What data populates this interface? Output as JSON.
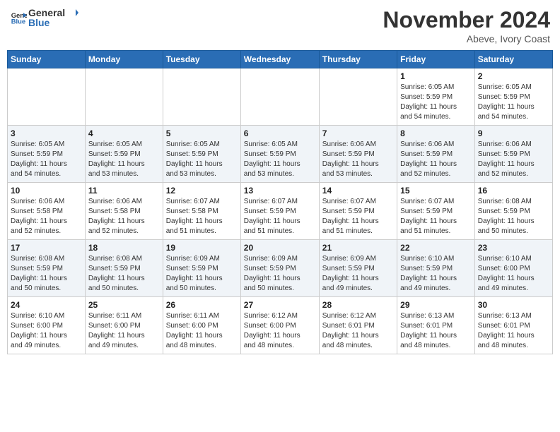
{
  "header": {
    "logo_general": "General",
    "logo_blue": "Blue",
    "month_year": "November 2024",
    "location": "Abeve, Ivory Coast"
  },
  "days_of_week": [
    "Sunday",
    "Monday",
    "Tuesday",
    "Wednesday",
    "Thursday",
    "Friday",
    "Saturday"
  ],
  "weeks": [
    [
      {
        "day": "",
        "info": ""
      },
      {
        "day": "",
        "info": ""
      },
      {
        "day": "",
        "info": ""
      },
      {
        "day": "",
        "info": ""
      },
      {
        "day": "",
        "info": ""
      },
      {
        "day": "1",
        "info": "Sunrise: 6:05 AM\nSunset: 5:59 PM\nDaylight: 11 hours\nand 54 minutes."
      },
      {
        "day": "2",
        "info": "Sunrise: 6:05 AM\nSunset: 5:59 PM\nDaylight: 11 hours\nand 54 minutes."
      }
    ],
    [
      {
        "day": "3",
        "info": "Sunrise: 6:05 AM\nSunset: 5:59 PM\nDaylight: 11 hours\nand 54 minutes."
      },
      {
        "day": "4",
        "info": "Sunrise: 6:05 AM\nSunset: 5:59 PM\nDaylight: 11 hours\nand 53 minutes."
      },
      {
        "day": "5",
        "info": "Sunrise: 6:05 AM\nSunset: 5:59 PM\nDaylight: 11 hours\nand 53 minutes."
      },
      {
        "day": "6",
        "info": "Sunrise: 6:05 AM\nSunset: 5:59 PM\nDaylight: 11 hours\nand 53 minutes."
      },
      {
        "day": "7",
        "info": "Sunrise: 6:06 AM\nSunset: 5:59 PM\nDaylight: 11 hours\nand 53 minutes."
      },
      {
        "day": "8",
        "info": "Sunrise: 6:06 AM\nSunset: 5:59 PM\nDaylight: 11 hours\nand 52 minutes."
      },
      {
        "day": "9",
        "info": "Sunrise: 6:06 AM\nSunset: 5:59 PM\nDaylight: 11 hours\nand 52 minutes."
      }
    ],
    [
      {
        "day": "10",
        "info": "Sunrise: 6:06 AM\nSunset: 5:58 PM\nDaylight: 11 hours\nand 52 minutes."
      },
      {
        "day": "11",
        "info": "Sunrise: 6:06 AM\nSunset: 5:58 PM\nDaylight: 11 hours\nand 52 minutes."
      },
      {
        "day": "12",
        "info": "Sunrise: 6:07 AM\nSunset: 5:58 PM\nDaylight: 11 hours\nand 51 minutes."
      },
      {
        "day": "13",
        "info": "Sunrise: 6:07 AM\nSunset: 5:59 PM\nDaylight: 11 hours\nand 51 minutes."
      },
      {
        "day": "14",
        "info": "Sunrise: 6:07 AM\nSunset: 5:59 PM\nDaylight: 11 hours\nand 51 minutes."
      },
      {
        "day": "15",
        "info": "Sunrise: 6:07 AM\nSunset: 5:59 PM\nDaylight: 11 hours\nand 51 minutes."
      },
      {
        "day": "16",
        "info": "Sunrise: 6:08 AM\nSunset: 5:59 PM\nDaylight: 11 hours\nand 50 minutes."
      }
    ],
    [
      {
        "day": "17",
        "info": "Sunrise: 6:08 AM\nSunset: 5:59 PM\nDaylight: 11 hours\nand 50 minutes."
      },
      {
        "day": "18",
        "info": "Sunrise: 6:08 AM\nSunset: 5:59 PM\nDaylight: 11 hours\nand 50 minutes."
      },
      {
        "day": "19",
        "info": "Sunrise: 6:09 AM\nSunset: 5:59 PM\nDaylight: 11 hours\nand 50 minutes."
      },
      {
        "day": "20",
        "info": "Sunrise: 6:09 AM\nSunset: 5:59 PM\nDaylight: 11 hours\nand 50 minutes."
      },
      {
        "day": "21",
        "info": "Sunrise: 6:09 AM\nSunset: 5:59 PM\nDaylight: 11 hours\nand 49 minutes."
      },
      {
        "day": "22",
        "info": "Sunrise: 6:10 AM\nSunset: 5:59 PM\nDaylight: 11 hours\nand 49 minutes."
      },
      {
        "day": "23",
        "info": "Sunrise: 6:10 AM\nSunset: 6:00 PM\nDaylight: 11 hours\nand 49 minutes."
      }
    ],
    [
      {
        "day": "24",
        "info": "Sunrise: 6:10 AM\nSunset: 6:00 PM\nDaylight: 11 hours\nand 49 minutes."
      },
      {
        "day": "25",
        "info": "Sunrise: 6:11 AM\nSunset: 6:00 PM\nDaylight: 11 hours\nand 49 minutes."
      },
      {
        "day": "26",
        "info": "Sunrise: 6:11 AM\nSunset: 6:00 PM\nDaylight: 11 hours\nand 48 minutes."
      },
      {
        "day": "27",
        "info": "Sunrise: 6:12 AM\nSunset: 6:00 PM\nDaylight: 11 hours\nand 48 minutes."
      },
      {
        "day": "28",
        "info": "Sunrise: 6:12 AM\nSunset: 6:01 PM\nDaylight: 11 hours\nand 48 minutes."
      },
      {
        "day": "29",
        "info": "Sunrise: 6:13 AM\nSunset: 6:01 PM\nDaylight: 11 hours\nand 48 minutes."
      },
      {
        "day": "30",
        "info": "Sunrise: 6:13 AM\nSunset: 6:01 PM\nDaylight: 11 hours\nand 48 minutes."
      }
    ]
  ]
}
